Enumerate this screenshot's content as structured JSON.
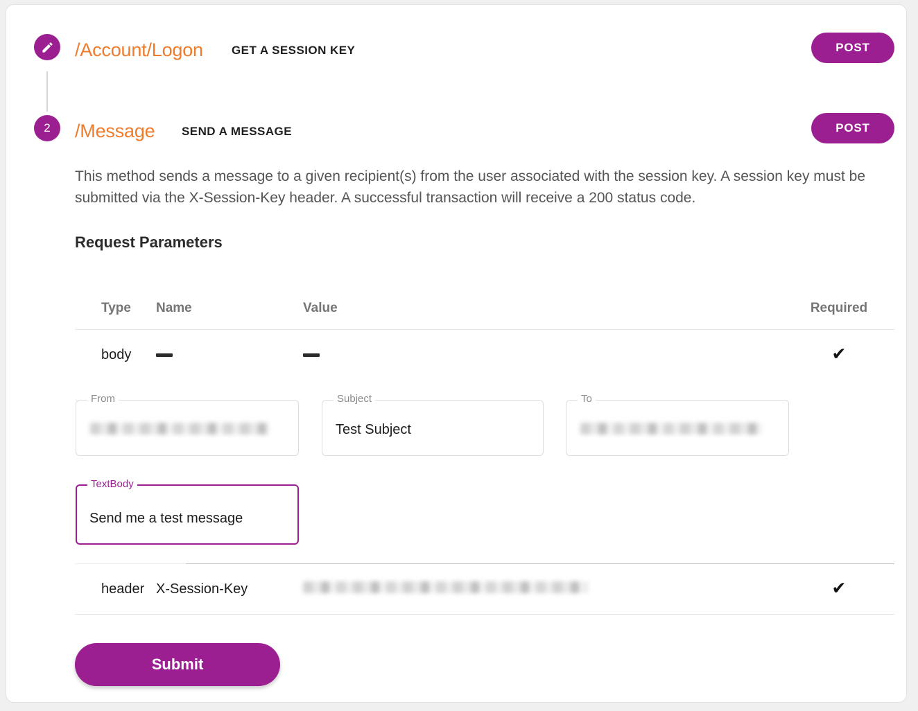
{
  "theme": {
    "accent_purple": "#9C1F92",
    "route_orange": "#EF7C2C",
    "page_background": "#F0F0F0",
    "card_background": "#FFFFFF"
  },
  "steps": [
    {
      "bullet_icon": "pencil-icon",
      "bullet_label": "",
      "route": "/Account/Logon",
      "summary": "GET A SESSION KEY",
      "method": "POST"
    },
    {
      "bullet_icon": "step-number",
      "bullet_label": "2",
      "route": "/Message",
      "summary": "SEND A MESSAGE",
      "method": "POST"
    }
  ],
  "panel": {
    "description": "This method sends a message to a given recipient(s) from the user associated with the session key. A session key must be submitted via the X-Session-Key header. A successful transaction will receive a 200 status code.",
    "section_title": "Request Parameters"
  },
  "params_table": {
    "headers": {
      "type": "Type",
      "name": "Name",
      "value": "Value",
      "required": "Required"
    },
    "rows": [
      {
        "type": "body",
        "name": "—",
        "name_is_dash": true,
        "value": "—",
        "value_is_dash": true,
        "required": true,
        "required_glyph": "✔"
      },
      {
        "type": "header",
        "name": "X-Session-Key",
        "name_is_dash": false,
        "value": "",
        "value_is_redacted": true,
        "required": true,
        "required_glyph": "✔"
      }
    ]
  },
  "body_fields": [
    {
      "label": "From",
      "value": "",
      "redacted": true,
      "focused": false
    },
    {
      "label": "Subject",
      "value": "Test Subject",
      "redacted": false,
      "focused": false
    },
    {
      "label": "To",
      "value": "",
      "redacted": true,
      "focused": false
    },
    {
      "label": "TextBody",
      "value": "Send me a test message",
      "redacted": false,
      "focused": true
    }
  ],
  "submit": {
    "label": "Submit"
  }
}
